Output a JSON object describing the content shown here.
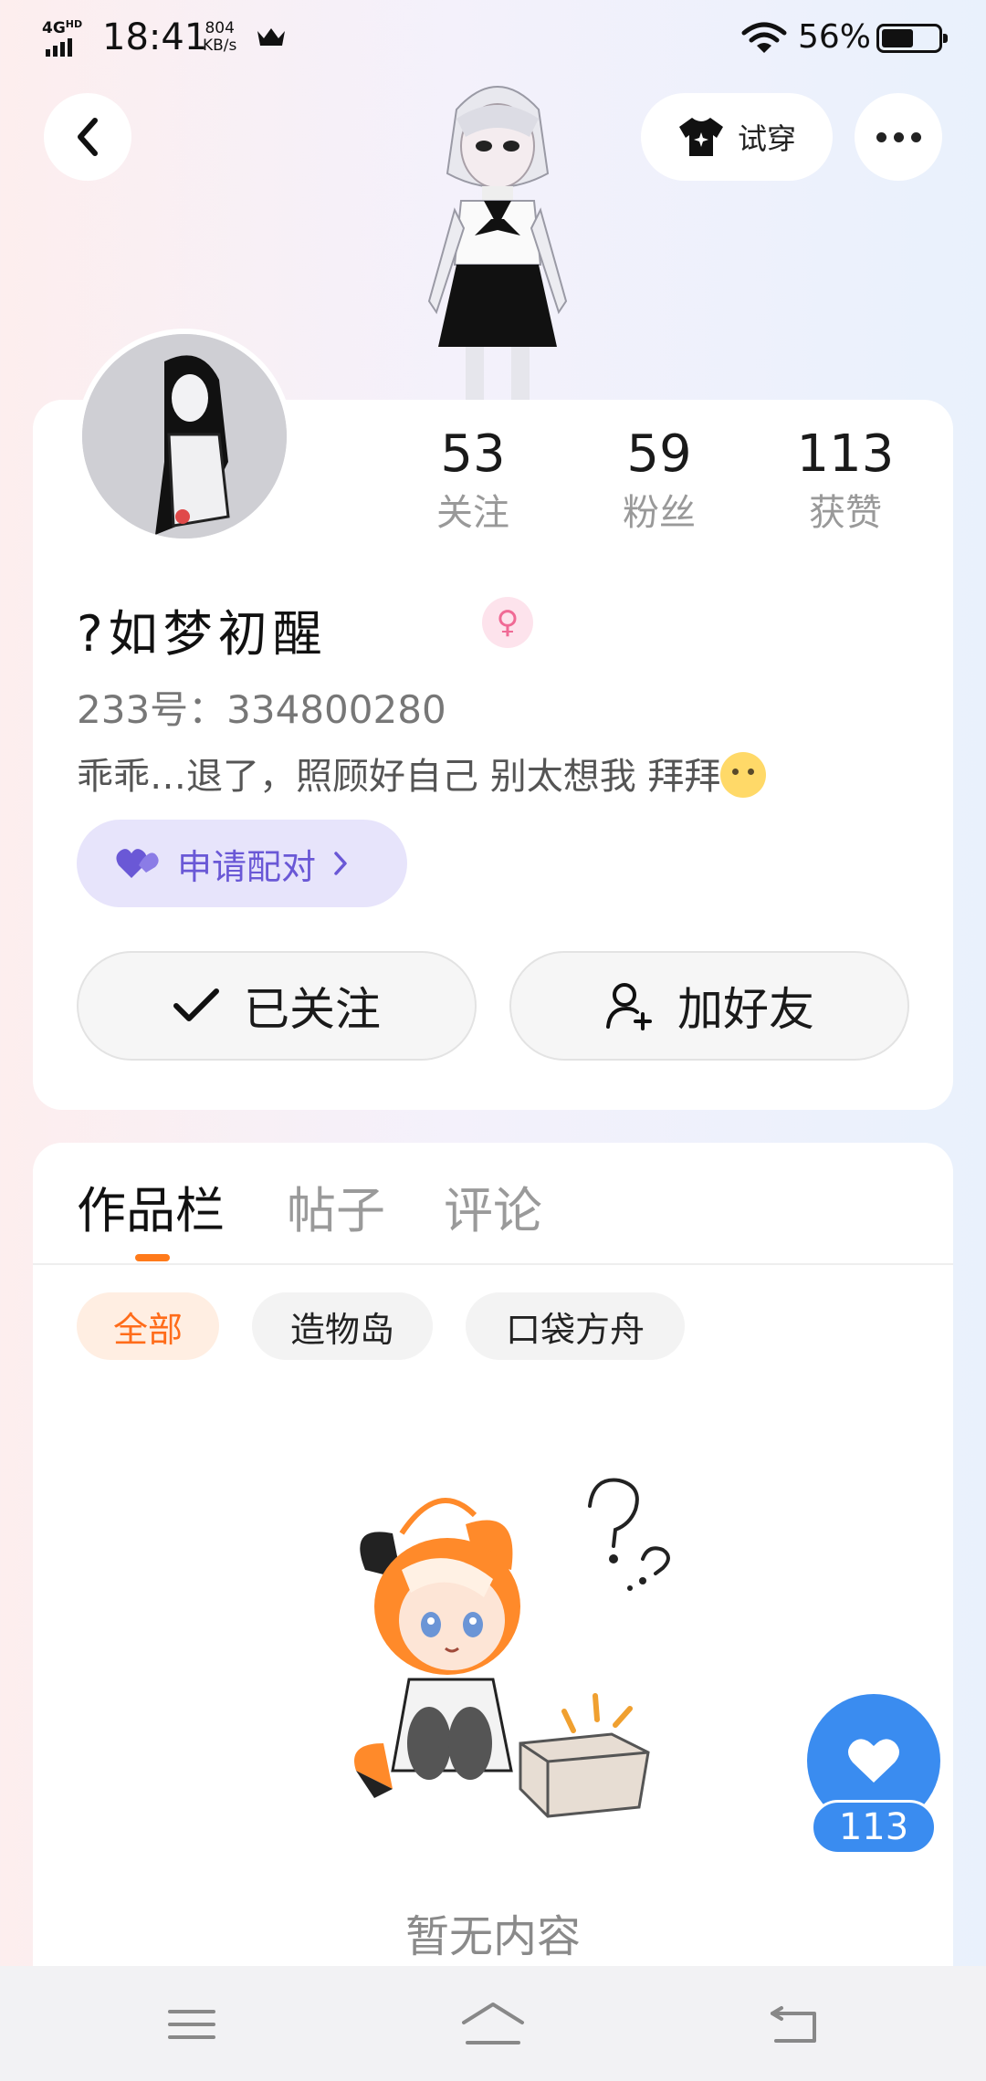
{
  "status_bar": {
    "network": "4G",
    "network_sup": "HD",
    "time": "18:41",
    "speed_value": "804",
    "speed_unit": "KB/s",
    "battery_percent": "56%",
    "battery_level": 0.56,
    "icons": [
      "signal-icon",
      "crown-icon",
      "wifi-icon",
      "battery-icon"
    ]
  },
  "header": {
    "tryon_label": "试穿",
    "icons": [
      "back-icon",
      "shirt-icon",
      "more-icon"
    ]
  },
  "profile": {
    "stats": [
      {
        "value": "53",
        "label": "关注"
      },
      {
        "value": "59",
        "label": "粉丝"
      },
      {
        "value": "113",
        "label": "获赞"
      }
    ],
    "nickname": "?如梦初醒",
    "gender_icon": "female-icon",
    "uid": "233号：334800280",
    "bio": "乖乖…退了，照顾好自己 别太想我  拜拜",
    "pair_label": "申请配对",
    "follow_label": "已关注",
    "add_friend_label": "加好友"
  },
  "content": {
    "tabs": [
      "作品栏",
      "帖子",
      "评论"
    ],
    "active_tab": 0,
    "filters": [
      "全部",
      "造物岛",
      "口袋方舟"
    ],
    "active_filter": 0,
    "empty_text": "暂无内容"
  },
  "like_fab": {
    "count": "113",
    "icon": "heart-icon"
  },
  "nav_bar": {
    "icons": [
      "menu-icon",
      "home-icon",
      "back-nav-icon"
    ]
  },
  "colors": {
    "accent_orange": "#ff7a1a",
    "pair_purple": "#6a58d6",
    "like_blue": "#3a8cf0",
    "female_pink": "#f06a95"
  }
}
